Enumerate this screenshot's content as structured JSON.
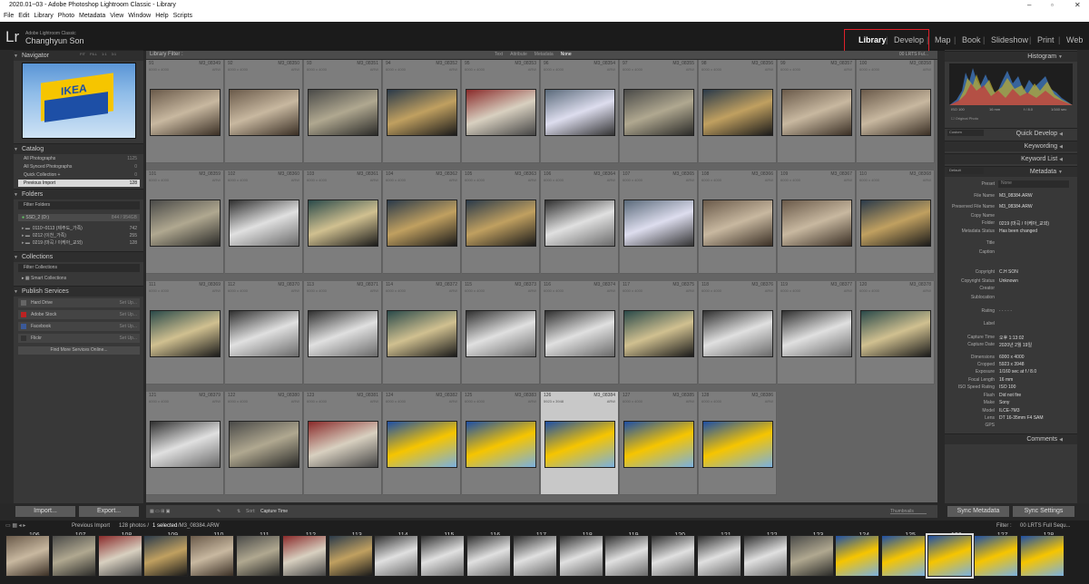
{
  "window": {
    "title": "2020.01~03 - Adobe Photoshop Lightroom Classic - Library"
  },
  "menu": [
    "File",
    "Edit",
    "Library",
    "Photo",
    "Metadata",
    "View",
    "Window",
    "Help",
    "Scripts"
  ],
  "identity": {
    "logo": "Lr",
    "sub": "Adobe Lightroom Classic",
    "user": "Changhyun Son"
  },
  "modules": [
    {
      "label": "Library",
      "active": true
    },
    {
      "label": "Develop"
    },
    {
      "label": "Map"
    },
    {
      "label": "Book"
    },
    {
      "label": "Slideshow"
    },
    {
      "label": "Print"
    },
    {
      "label": "Web"
    }
  ],
  "left": {
    "navigator": {
      "title": "Navigator",
      "zoom": [
        "FIT",
        "FILL",
        "1:1",
        "3:1"
      ]
    },
    "catalog": {
      "title": "Catalog",
      "items": [
        {
          "label": "All Photographs",
          "count": "1125"
        },
        {
          "label": "All Synced Photographs",
          "count": "0"
        },
        {
          "label": "Quick Collection +",
          "count": "0"
        },
        {
          "label": "Previous Import",
          "count": "128"
        }
      ]
    },
    "folders": {
      "title": "Folders",
      "filter": "Filter Folders",
      "drive": "SSD_2 (D:)",
      "drive_info": "844 / 954GB",
      "items": [
        {
          "label": "0110~0113 (제주도_가족)",
          "count": "742"
        },
        {
          "label": "0212 (이천_가족)",
          "count": "255"
        },
        {
          "label": "0219 (마곡 / 이케아_교외)",
          "count": "128"
        }
      ]
    },
    "collections": {
      "title": "Collections",
      "filter": "Filter Collections",
      "items": [
        "Smart Collections"
      ]
    },
    "publish": {
      "title": "Publish Services",
      "items": [
        {
          "label": "Hard Drive",
          "action": "Set Up..."
        },
        {
          "label": "Adobe Stock",
          "action": "Set Up..."
        },
        {
          "label": "Facebook",
          "action": "Set Up..."
        },
        {
          "label": "Flickr",
          "action": "Set Up..."
        }
      ],
      "more": "Find More Services Online..."
    },
    "import": "Import...",
    "export": "Export..."
  },
  "filterbar": {
    "label": "Library Filter :",
    "tabs": [
      "Text",
      "Attribute",
      "Metadata",
      "None"
    ],
    "right": "00 LRTS Ful..."
  },
  "grid_rows": [
    {
      "start": 91,
      "names": [
        "M3_08349",
        "M3_08350",
        "M3_08351",
        "M3_08352",
        "M3_08353",
        "M3_08354",
        "M3_08355",
        "M3_08356",
        "M3_08357",
        "M3_08358"
      ]
    },
    {
      "start": 101,
      "names": [
        "M3_08359",
        "M3_08360",
        "M3_08361",
        "M3_08362",
        "M3_08363",
        "M3_08364",
        "M3_08365",
        "M3_08366",
        "M3_08367",
        "M3_08368"
      ]
    },
    {
      "start": 111,
      "names": [
        "M3_08369",
        "M3_08370",
        "M3_08371",
        "M3_08372",
        "M3_08373",
        "M3_08374",
        "M3_08375",
        "M3_08376",
        "M3_08377",
        "M3_08378"
      ]
    },
    {
      "start": 121,
      "names": [
        "M3_08379",
        "M3_08380",
        "M3_08381",
        "M3_08382",
        "M3_08383",
        "M3_08384",
        "M3_08385",
        "M3_08386"
      ]
    }
  ],
  "cell_dim": "6000 x 4000",
  "cell_ext": "ARW",
  "selected": {
    "index": "126",
    "dim": "5923 x 3948"
  },
  "toolbar": {
    "sort_label": "Sort:",
    "sort_value": "Capture Time",
    "thumbs": "Thumbnails"
  },
  "right": {
    "histogram": {
      "title": "Histogram",
      "iso": "ISO 100",
      "focal": "16 mm",
      "aperture": "f / 8.0",
      "shutter": "1/160 sec",
      "original": "Original Photo"
    },
    "quick_develop": {
      "title": "Quick Develop",
      "preset": "Custom"
    },
    "keywording": "Keywording",
    "keyword_list": "Keyword List",
    "metadata": {
      "title": "Metadata",
      "preset_label": "Preset",
      "preset_value": "None",
      "view": "Default",
      "fields": [
        {
          "k": "File Name",
          "v": "M3_08384.ARW"
        },
        {
          "k": "Preserved File Name",
          "v": "M3_08384.ARW"
        },
        {
          "k": "Copy Name",
          "v": ""
        },
        {
          "k": "Folder",
          "v": "0219 (마곡 / 이케아_교외)"
        },
        {
          "k": "Metadata Status",
          "v": "Has been changed"
        },
        {
          "k": "Title",
          "v": ""
        },
        {
          "k": "Caption",
          "v": ""
        },
        {
          "k": "Copyright",
          "v": "C.H SON"
        },
        {
          "k": "Copyright Status",
          "v": "Unknown"
        },
        {
          "k": "Creator",
          "v": ""
        },
        {
          "k": "Sublocation",
          "v": ""
        },
        {
          "k": "Rating",
          "v": "· · · · ·"
        },
        {
          "k": "Label",
          "v": ""
        },
        {
          "k": "Capture Time",
          "v": "오후 1:13:02"
        },
        {
          "k": "Capture Date",
          "v": "2020년 2월 19일"
        },
        {
          "k": "Dimensions",
          "v": "6000 x 4000"
        },
        {
          "k": "Cropped",
          "v": "5923 x 3948"
        },
        {
          "k": "Exposure",
          "v": "1/160 sec at f / 8.0"
        },
        {
          "k": "Focal Length",
          "v": "16 mm"
        },
        {
          "k": "ISO Speed Rating",
          "v": "ISO 100"
        },
        {
          "k": "Flash",
          "v": "Did not fire"
        },
        {
          "k": "Make",
          "v": "Sony"
        },
        {
          "k": "Model",
          "v": "ILCE-7M3"
        },
        {
          "k": "Lens",
          "v": "DT 16-35mm F4 SAM"
        },
        {
          "k": "GPS",
          "v": ""
        }
      ]
    },
    "comments": "Comments",
    "sync_metadata": "Sync Metadata",
    "sync_settings": "Sync Settings"
  },
  "filmstrip": {
    "source": "Previous Import",
    "count": "128 photos /",
    "selected": "1 selected",
    "file": "/M3_08384.ARW",
    "filter_label": "Filter :",
    "filter_value": "00 LRTS Full Sequ...",
    "numbers": [
      "106",
      "107",
      "108",
      "109",
      "110",
      "111",
      "112",
      "113",
      "114",
      "115",
      "116",
      "117",
      "118",
      "119",
      "120",
      "121",
      "122",
      "123",
      "124",
      "125",
      "126",
      "127",
      "128"
    ]
  },
  "colors": {
    "accent_red": "#e0202a",
    "grid_bg": "#646464",
    "cell_bg": "#7d7d7d",
    "cell_selected": "#c8c8c8"
  }
}
